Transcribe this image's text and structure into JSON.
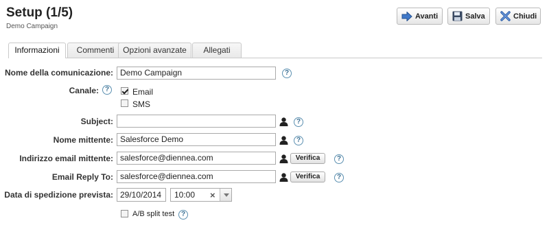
{
  "header": {
    "title": "Setup (1/5)",
    "subtitle": "Demo Campaign"
  },
  "toolbar": {
    "next_label": "Avanti",
    "save_label": "Salva",
    "close_label": "Chiudi"
  },
  "tabs": [
    {
      "label": "Informazioni",
      "active": true
    },
    {
      "label": "Commenti",
      "active": false
    },
    {
      "label": "Opzioni avanzate",
      "active": false
    },
    {
      "label": "Allegati",
      "active": false
    }
  ],
  "form": {
    "name_label": "Nome della comunicazione:",
    "name_value": "Demo Campaign",
    "channel_label": "Canale:",
    "channel_email_label": "Email",
    "channel_email_checked": true,
    "channel_sms_label": "SMS",
    "channel_sms_checked": false,
    "subject_label": "Subject:",
    "subject_value": "",
    "sender_name_label": "Nome mittente:",
    "sender_name_value": "Salesforce Demo",
    "sender_email_label": "Indirizzo email mittente:",
    "sender_email_value": "salesforce@diennea.com",
    "reply_to_label": "Email Reply To:",
    "reply_to_value": "salesforce@diennea.com",
    "verify_label": "Verifica",
    "send_date_label": "Data di spedizione prevista:",
    "send_date_value": "29/10/2014",
    "send_time_value": "10:00",
    "ab_test_label": "A/B split test",
    "ab_test_checked": false,
    "help_symbol": "?"
  },
  "icons": {
    "next": "arrow-right-icon",
    "save": "floppy-disk-icon",
    "close": "close-x-icon",
    "user": "user-icon",
    "help": "help-icon",
    "clear": "clear-x-icon",
    "dropdown": "chevron-down-icon"
  },
  "colors": {
    "accent_blue": "#3f78c9",
    "help_blue": "#3b6f93",
    "button_border": "#b9b9b9",
    "tab_border": "#c9c9c9"
  }
}
